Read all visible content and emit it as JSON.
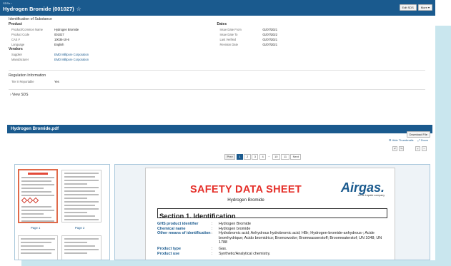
{
  "header": {
    "breadcrumb": "SDSs ›",
    "title": "Hydrogen Bromide (001027)",
    "edit_label": "Edit SDS",
    "more_label": "More ▾"
  },
  "identification": {
    "section_title": "Identification of Substance",
    "product_title": "Product",
    "product_rows": [
      {
        "key": "Product/Common Name",
        "value": "Hydrogen Bromide"
      },
      {
        "key": "Product Code",
        "value": "001027"
      },
      {
        "key": "CAS #",
        "value": "10035-10-6"
      },
      {
        "key": "Language",
        "value": "English"
      }
    ],
    "dates_title": "Dates",
    "date_rows": [
      {
        "key": "Issue Date From",
        "value": "01/07/2021"
      },
      {
        "key": "Issue Date To",
        "value": "01/07/2022"
      },
      {
        "key": "Last Verified",
        "value": "01/07/2021"
      },
      {
        "key": "Revision Date",
        "value": "01/07/2021"
      }
    ],
    "vendors_title": "Vendors",
    "vendor_rows": [
      {
        "key": "Supplier",
        "value": "EMD Millipore Corporation"
      },
      {
        "key": "Manufacturer",
        "value": "EMD Millipore Corporation"
      }
    ]
  },
  "regulation": {
    "title": "Regulation Information",
    "rows": [
      {
        "key": "Tier II Reportable",
        "value": "Yes"
      }
    ]
  },
  "view_sds": "› View SDS",
  "file": {
    "name": "Hydrogen Bromide.pdf",
    "download_label": "Download File",
    "hide_thumbnails": "⊟ Hide Thumbnails",
    "zoom": "⤢ Zoom"
  },
  "pager": {
    "prev": "Prev",
    "pages": [
      "1",
      "2",
      "3",
      "4"
    ],
    "dots": "...",
    "tail_pages": [
      "10",
      "11"
    ],
    "next": "Next",
    "active": "1"
  },
  "thumbnails": {
    "labels": [
      "Page 1",
      "Page 2"
    ]
  },
  "document": {
    "title": "SAFETY DATA SHEET",
    "subtitle": "Hydrogen Bromide",
    "logo": "Airgas.",
    "logo_tag": "an Air Liquide company",
    "section": "Section 1. Identification",
    "rows": [
      {
        "key": "GHS product identifier",
        "value": "Hydrogen Bromide"
      },
      {
        "key": "Chemical name",
        "value": "Hydrogen bromide"
      },
      {
        "key": "Other means of identification",
        "value": "Hydrobromic acid; Anhydrous hydrobromic acid; HBr; Hydrogen-bromide-anhydrous-; Acide bromhydrique; Acido bromidrico; Bromowodor; Bromwasserstoff; Broomwaterstof; UN 1048; UN 1788"
      },
      {
        "key": "Product type",
        "value": "Gas."
      },
      {
        "key": "Product use",
        "value": "Synthetic/Analytical chemistry."
      }
    ]
  },
  "colors": {
    "brand_blue": "#1a5a8e",
    "sds_red": "#e5302a",
    "accent_teal": "#c9e6ee"
  }
}
